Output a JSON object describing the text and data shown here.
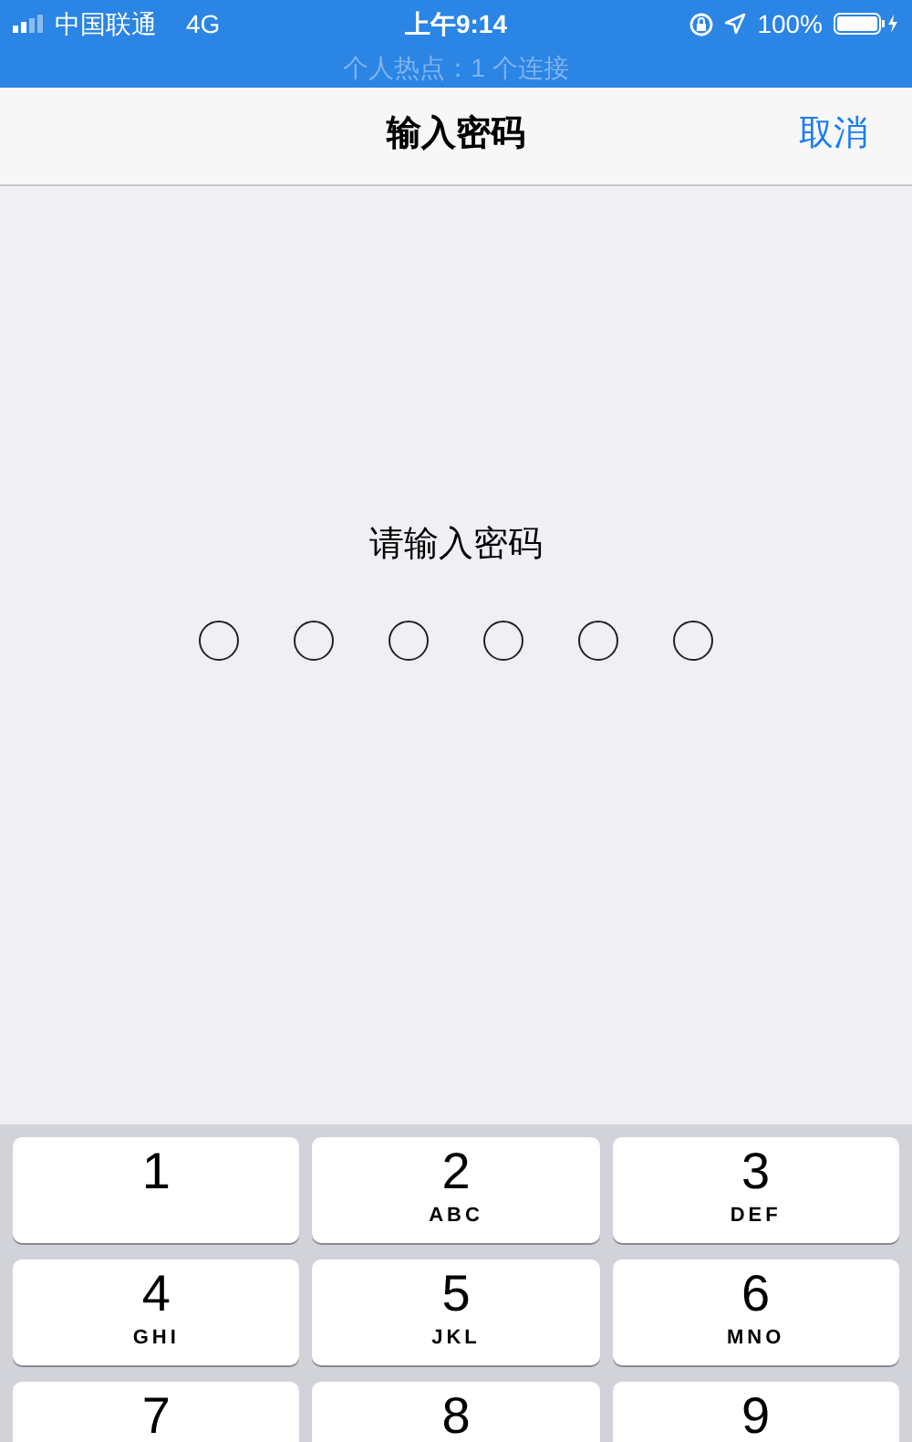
{
  "status_bar": {
    "carrier": "中国联通",
    "network": "4G",
    "time": "上午9:14",
    "battery": "100%",
    "hotspot": "个人热点：1 个连接"
  },
  "nav_bar": {
    "title": "输入密码",
    "cancel": "取消"
  },
  "prompt": "请输入密码",
  "passcode": [
    {
      "filled": false
    },
    {
      "filled": false
    },
    {
      "filled": false
    },
    {
      "filled": false
    },
    {
      "filled": false
    },
    {
      "filled": false
    }
  ],
  "keypad": [
    {
      "digit": "1"
    },
    {
      "digit": "2",
      "letters": "ABC"
    },
    {
      "digit": "3",
      "letters": "DEF"
    },
    {
      "digit": "4",
      "letters": "GHI"
    },
    {
      "digit": "5",
      "letters": "JKL"
    },
    {
      "digit": "6",
      "letters": "MNO"
    },
    {
      "digit": "7"
    },
    {
      "digit": "8"
    },
    {
      "digit": "9"
    }
  ]
}
